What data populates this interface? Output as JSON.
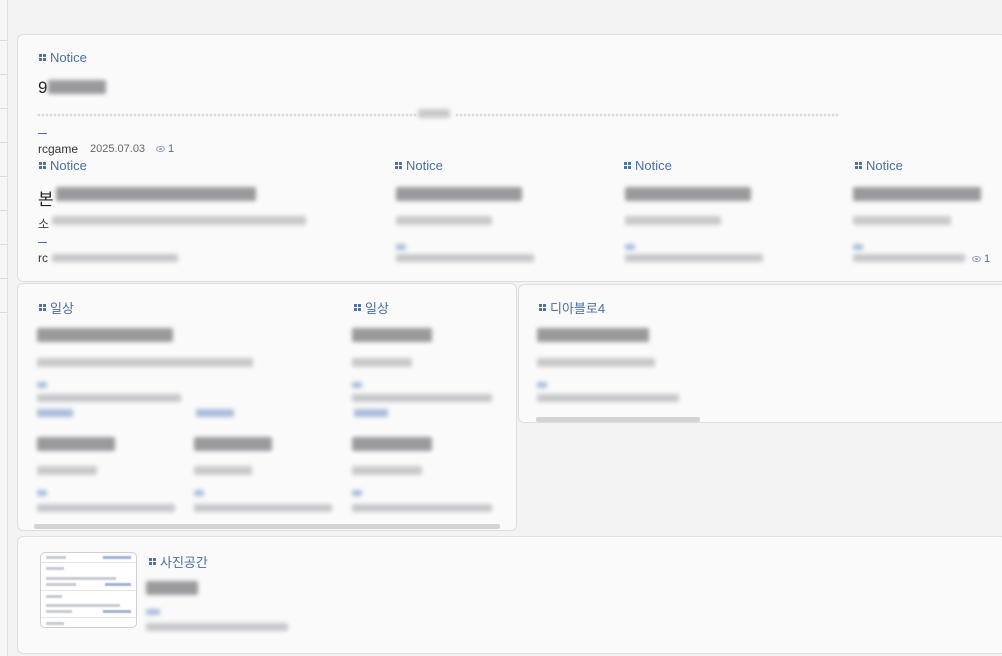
{
  "featured": {
    "category": "Notice",
    "title_initial": "9",
    "author": "rcgame",
    "date": "2025.07.03",
    "views": "1"
  },
  "notice_row": [
    {
      "category": "Notice",
      "title_initial": "본",
      "sub_initial": "소",
      "author_initial": "rc",
      "views": ""
    },
    {
      "category": "Notice",
      "title_initial": "",
      "sub_initial": "",
      "author_initial": "",
      "views": ""
    },
    {
      "category": "Notice",
      "title_initial": "",
      "sub_initial": "",
      "author_initial": "",
      "views": ""
    },
    {
      "category": "Notice",
      "title_initial": "",
      "sub_initial": "",
      "author_initial": "",
      "views": "1"
    }
  ],
  "daily": {
    "col1_category": "일상",
    "col2_category": "일상"
  },
  "diablo": {
    "category": "디아블로4"
  },
  "photo": {
    "category": "사진공간"
  },
  "icons": {
    "category": "grid-icon",
    "views": "eye-icon"
  }
}
